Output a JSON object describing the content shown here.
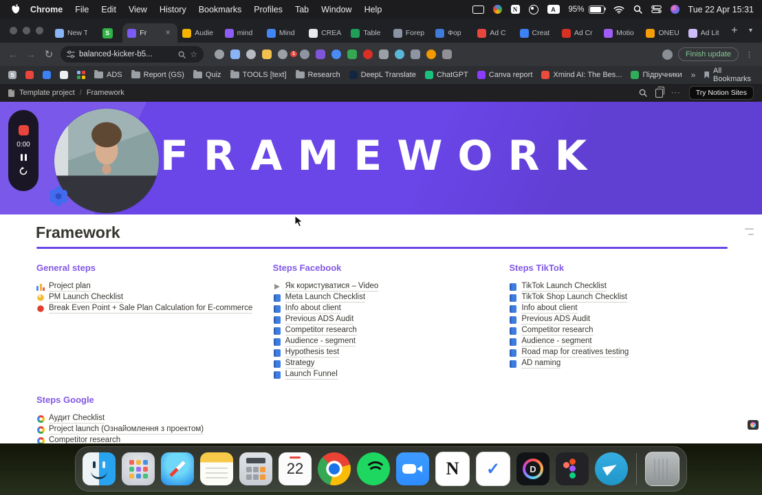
{
  "menubar": {
    "app": "Chrome",
    "menus": [
      "File",
      "Edit",
      "View",
      "History",
      "Bookmarks",
      "Profiles",
      "Tab",
      "Window",
      "Help"
    ],
    "input_source": "A",
    "battery": "95%",
    "clock": "Tue 22 Apr 15:31"
  },
  "tabstrip": {
    "tabs": [
      {
        "label": "New T",
        "color": "#8ab4f8"
      },
      {
        "label": "S",
        "color": "#2fb344"
      },
      {
        "label": "Fr",
        "color": "#7b5bf5"
      },
      {
        "label": "Audie",
        "color": "#f4b400"
      },
      {
        "label": "mind",
        "color": "#8e5cf6"
      },
      {
        "label": "Mind",
        "color": "#4285f4"
      },
      {
        "label": "CREA",
        "color": "#e8eaed"
      },
      {
        "label": "Table",
        "color": "#1e9e57"
      },
      {
        "label": "Forep",
        "color": "#8a93a3"
      },
      {
        "label": "Фор",
        "color": "#3f7bd9"
      },
      {
        "label": "Ad C",
        "color": "#e8453c"
      },
      {
        "label": "Creat",
        "color": "#3b82f6"
      },
      {
        "label": "Ad Cr",
        "color": "#d93025"
      },
      {
        "label": "Motio",
        "color": "#a05cf7"
      },
      {
        "label": "ONEU",
        "color": "#f59e0b"
      },
      {
        "label": "Ad Lit",
        "color": "#cdbcfa"
      }
    ]
  },
  "toolbar": {
    "url": "balanced-kicker-b5...",
    "update_label": "Finish update",
    "badge": "1",
    "extensions": [
      "#9aa0a6",
      "#8ab4f8",
      "#b8bcc2",
      "#f2c14e",
      "#9aa0a6",
      "#e8453c",
      "#8f95a0",
      "#7f56d9",
      "#4b8bf5",
      "#34a853",
      "#d93025",
      "#9aa0a6",
      "#59b7d8",
      "#8f95a0",
      "#f29900",
      "#8f8f95"
    ]
  },
  "bookmarks": {
    "icon_bookmarks": [
      {
        "letter": "S",
        "color": "#a7adb5"
      },
      {
        "letter": "",
        "color": "#e8453c"
      },
      {
        "letter": "",
        "color": "#3b82f6"
      },
      {
        "letter": "",
        "color": "#eceef0"
      },
      {
        "letter": "",
        "color": "#8ab4f8"
      }
    ],
    "folders": [
      "ADS",
      "Report (GS)",
      "Quiz",
      "TOOLS [text]",
      "Research"
    ],
    "links": [
      {
        "label": "DeepL Translate",
        "color": "#13263f"
      },
      {
        "label": "ChatGPT",
        "color": "#19c37d"
      },
      {
        "label": "Canva report",
        "color": "#8b3dff"
      },
      {
        "label": "Xmind AI: The Bes...",
        "color": "#eb4b3d"
      },
      {
        "label": "Підручники",
        "color": "#2fae5a"
      }
    ],
    "overflow": "»",
    "all_bookmarks": "All Bookmarks"
  },
  "notion": {
    "breadcrumb_root": "Template project",
    "breadcrumb_sep": "/",
    "breadcrumb_page": "Framework",
    "cta": "Try Notion Sites",
    "banner_title": "FRAMEWORK",
    "page_title": "Framework"
  },
  "recorder": {
    "time": "0:00"
  },
  "sections": {
    "general": {
      "title": "General steps",
      "items": [
        {
          "icon": "chart-icon",
          "label": "Project plan"
        },
        {
          "icon": "bulb-icon",
          "label": "PM Launch Checklist"
        },
        {
          "icon": "dot-red-icon",
          "label": "Break Even Point + Sale Plan Calculation for E-commerce"
        }
      ]
    },
    "facebook": {
      "title": "Steps Facebook",
      "items": [
        {
          "icon": "play-icon",
          "label": "Як користуватися – Video"
        },
        {
          "icon": "book-icon",
          "label": "Meta Launch Checklist"
        },
        {
          "icon": "book-icon",
          "label": "Info about client"
        },
        {
          "icon": "book-icon",
          "label": "Previous ADS Audit"
        },
        {
          "icon": "book-icon",
          "label": "Competitor research"
        },
        {
          "icon": "book-icon",
          "label": "Audience - segment"
        },
        {
          "icon": "book-icon",
          "label": "Hypothesis test"
        },
        {
          "icon": "book-icon",
          "label": "Strategy"
        },
        {
          "icon": "book-icon",
          "label": "Launch Funnel"
        }
      ]
    },
    "tiktok": {
      "title": "Steps TikTok",
      "items": [
        {
          "icon": "book-icon",
          "label": "TikTok Launch Checklist"
        },
        {
          "icon": "book-icon",
          "label": "TikTok Shop Launch Checklist"
        },
        {
          "icon": "book-icon",
          "label": "Info about client"
        },
        {
          "icon": "book-icon",
          "label": "Previous ADS Audit"
        },
        {
          "icon": "book-icon",
          "label": "Competitor research"
        },
        {
          "icon": "book-icon",
          "label": "Audience - segment"
        },
        {
          "icon": "book-icon",
          "label": "Road map for creatives testing"
        },
        {
          "icon": "book-icon",
          "label": "AD naming"
        }
      ]
    },
    "google": {
      "title": "Steps Google",
      "items": [
        {
          "icon": "google-icon",
          "label": "Аудит Checklist"
        },
        {
          "icon": "google-icon",
          "label": "Project launch (Ознайомлення з проектом)"
        },
        {
          "icon": "google-icon",
          "label": "Competitor research"
        }
      ]
    }
  },
  "dock": {
    "calendar_day": "22",
    "apps": [
      "finder",
      "launchpad",
      "safari",
      "notes",
      "calculator",
      "calendar",
      "chrome",
      "spotify",
      "zoom",
      "notion",
      "things",
      "davinci",
      "figma",
      "telegram",
      "trash"
    ]
  }
}
